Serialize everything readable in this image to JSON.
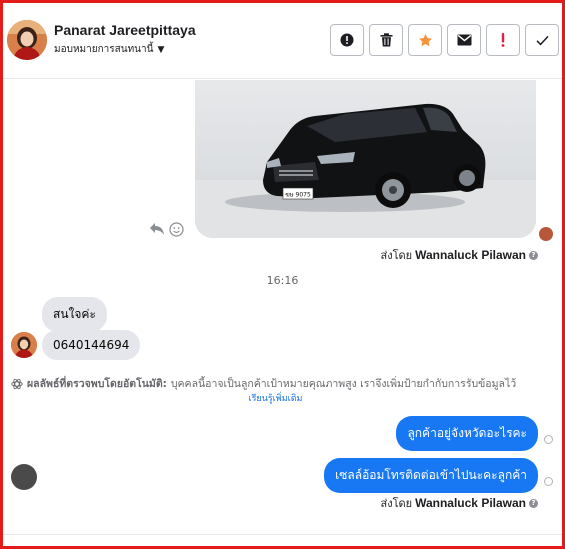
{
  "header": {
    "contact_name": "Panarat Jareetpittaya",
    "assign_label": "มอบหมายการสนทนานี้",
    "actions": [
      {
        "name": "alert-button",
        "icon": "info-circle-icon"
      },
      {
        "name": "delete-button",
        "icon": "trash-icon"
      },
      {
        "name": "star-button",
        "icon": "star-icon",
        "color": "#f7923a"
      },
      {
        "name": "mail-button",
        "icon": "envelope-icon"
      },
      {
        "name": "important-button",
        "icon": "exclamation-icon",
        "color": "#e41e3f"
      },
      {
        "name": "done-button",
        "icon": "check-icon"
      }
    ]
  },
  "chat": {
    "sent_by_prefix": "ส่งโดย",
    "sender_name": "Wannaluck Pilawan",
    "timestamp": "16:16",
    "car_plate": "ฆษ 9075",
    "incoming": [
      {
        "text": "สนใจค่ะ"
      },
      {
        "text": "0640144694"
      }
    ],
    "detection_notice": {
      "label": "ผลลัพธ์ที่ตรวจพบโดยอัตโนมัติ:",
      "text": "บุคคลนี้อาจเป็นลูกค้าเป้าหมายคุณภาพสูง เราจึงเพิ่มป้ายกำกับการรับข้อมูลไว้",
      "learn_more": "เรียนรู้เพิ่มเติม"
    },
    "outgoing": [
      {
        "text": "ลูกค้าอยู่จังหวัดอะไรคะ"
      },
      {
        "text": "เซลล์อ้อมโทรติดต่อเข้าไปนะคะลูกค้า"
      }
    ]
  },
  "colors": {
    "frame": "#e41b1b",
    "outgoing_bubble": "#1877f2",
    "incoming_bubble": "#e4e6eb",
    "link": "#1b74e4"
  }
}
